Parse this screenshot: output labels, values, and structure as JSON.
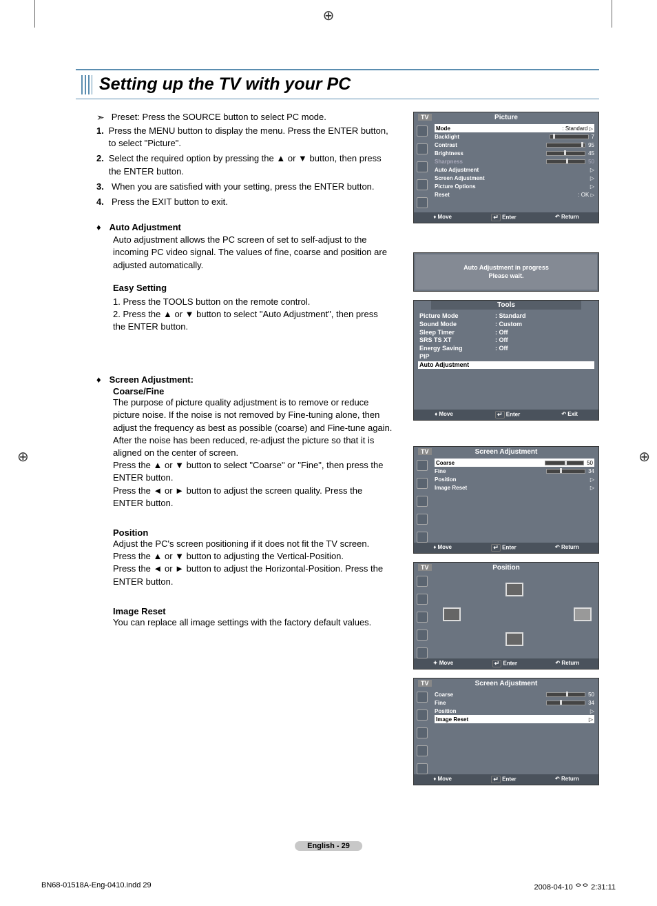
{
  "title": "Setting up the TV with your PC",
  "preset": "Preset: Press the SOURCE button to select PC mode.",
  "steps": {
    "s1": "Press the MENU button to display the menu. Press the ENTER button, to select \"Picture\".",
    "s2": "Select the required option by pressing the ▲ or ▼ button, then press the ENTER button.",
    "s3": "When you are satisfied with your setting, press the ENTER button.",
    "s4": "Press the EXIT button to exit."
  },
  "auto_adj": {
    "head": "Auto Adjustment",
    "body": "Auto adjustment allows the PC screen of set to self-adjust to the incoming PC video signal. The values of fine, coarse and position are adjusted automatically."
  },
  "easy": {
    "head": "Easy Setting",
    "s1": "1. Press the TOOLS button on the remote control.",
    "s2": "2. Press the ▲ or ▼ button to select \"Auto Adjustment\", then press the ENTER button."
  },
  "screen_adj": {
    "head": "Screen Adjustment:",
    "sub": "Coarse/Fine",
    "body": "The purpose of picture quality adjustment is to remove or reduce picture noise. If the noise is not removed by Fine-tuning alone, then adjust the frequency as best as possible (coarse) and Fine-tune again. After the noise has been reduced, re-adjust the picture so that it is aligned on the center of screen.",
    "l1": "Press the ▲ or ▼ button to select \"Coarse\" or \"Fine\", then press the ENTER button.",
    "l2": "Press the ◄ or ► button to adjust the screen quality. Press the ENTER button."
  },
  "position": {
    "head": "Position",
    "body": "Adjust the PC's screen positioning if it does not fit the TV screen.",
    "l1": "Press the ▲ or ▼ button to adjusting the Vertical-Position.",
    "l2": "Press the ◄ or ► button to adjust the Horizontal-Position. Press the ENTER button."
  },
  "img_reset": {
    "head": "Image Reset",
    "body": "You can replace all image settings with the factory default values."
  },
  "osd1": {
    "tv": "TV",
    "title": "Picture",
    "mode": "Mode",
    "mode_v": ": Standard",
    "backlight": "Backlight",
    "backlight_v": "7",
    "contrast": "Contrast",
    "contrast_v": "95",
    "brightness": "Brightness",
    "brightness_v": "45",
    "sharpness": "Sharpness",
    "sharpness_v": "50",
    "auto": "Auto Adjustment",
    "screen": "Screen Adjustment",
    "popt": "Picture Options",
    "reset": "Reset",
    "reset_v": ": OK",
    "move": "Move",
    "enter": "Enter",
    "return": "Return"
  },
  "osd2": {
    "msg1": "Auto Adjustment in progress",
    "msg2": "Please wait.",
    "tools": "Tools",
    "pm": "Picture Mode",
    "pm_v": ": Standard",
    "sm": "Sound Mode",
    "sm_v": ": Custom",
    "st": "Sleep Timer",
    "st_v": ": Off",
    "srs": "SRS TS XT",
    "srs_v": ": Off",
    "es": "Energy Saving",
    "es_v": ": Off",
    "pip": "PIP",
    "auto": "Auto Adjustment",
    "move": "Move",
    "enter": "Enter",
    "exit": "Exit"
  },
  "osd3": {
    "tv": "TV",
    "title": "Screen Adjustment",
    "coarse": "Coarse",
    "coarse_v": "50",
    "fine": "Fine",
    "fine_v": "34",
    "pos": "Position",
    "ir": "Image Reset",
    "move": "Move",
    "enter": "Enter",
    "return": "Return"
  },
  "osd4": {
    "tv": "TV",
    "title": "Position",
    "move": "Move",
    "enter": "Enter",
    "return": "Return"
  },
  "osd5": {
    "tv": "TV",
    "title": "Screen Adjustment",
    "coarse": "Coarse",
    "coarse_v": "50",
    "fine": "Fine",
    "fine_v": "34",
    "pos": "Position",
    "ir": "Image Reset",
    "move": "Move",
    "enter": "Enter",
    "return": "Return"
  },
  "page_num": "English - 29",
  "footer": {
    "file": "BN68-01518A-Eng-0410.indd   29",
    "time": "2008-04-10   ᄋᄋ 2:31:11"
  }
}
